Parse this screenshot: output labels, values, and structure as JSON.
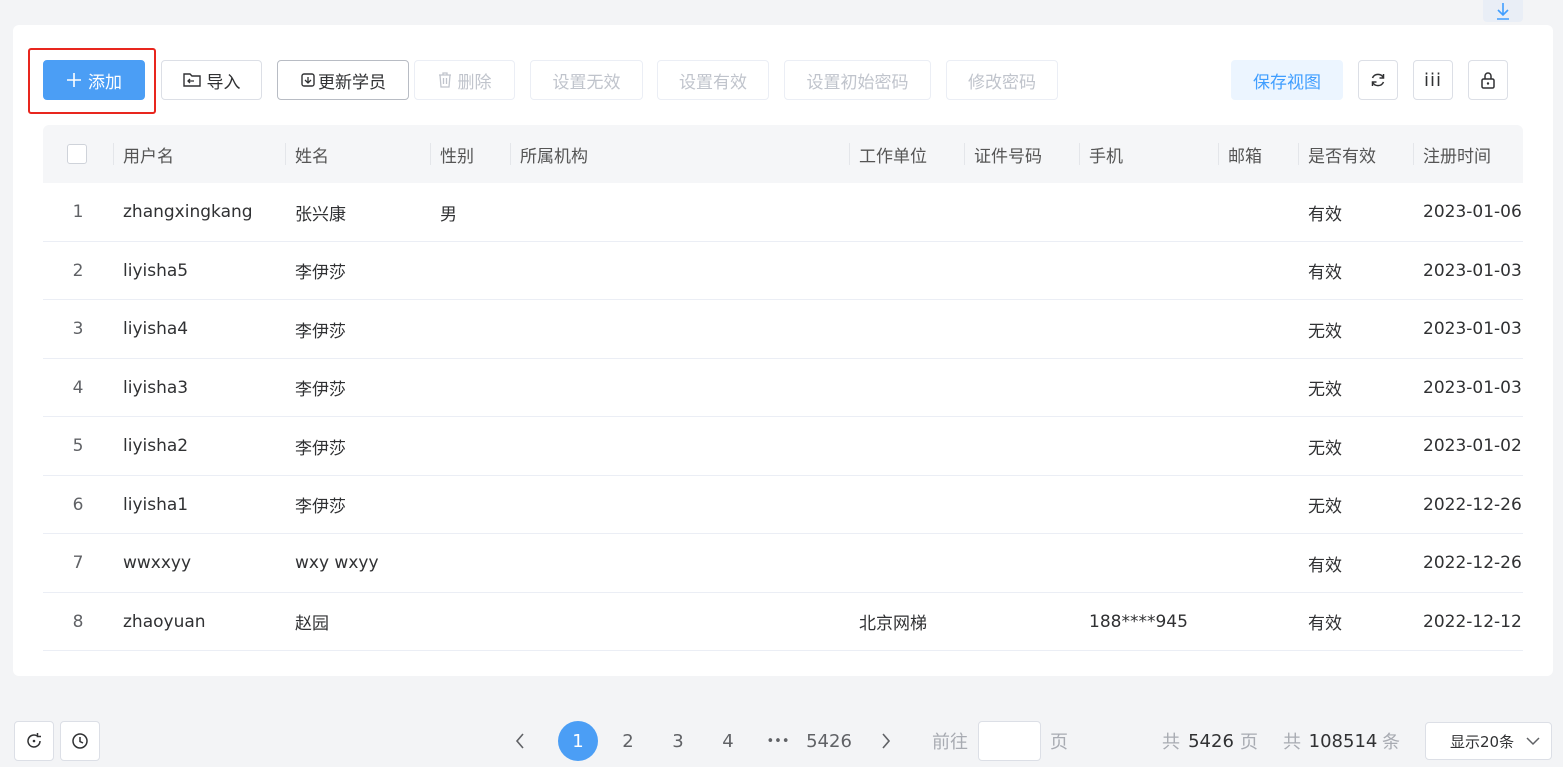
{
  "toolbar": {
    "add": "添加",
    "import": "导入",
    "update_students": "更新学员",
    "delete": "删除",
    "set_invalid": "设置无效",
    "set_valid": "设置有效",
    "set_initial_password": "设置初始密码",
    "change_password": "修改密码",
    "save_view": "保存视图",
    "columns_glyph": "iii"
  },
  "table": {
    "headers": {
      "username": "用户名",
      "name": "姓名",
      "gender": "性别",
      "org": "所属机构",
      "workplace": "工作单位",
      "id_number": "证件号码",
      "phone": "手机",
      "email": "邮箱",
      "valid": "是否有效",
      "reg_time": "注册时间"
    },
    "rows": [
      {
        "idx": "1",
        "username": "zhangxingkang",
        "name": "张兴康",
        "gender": "男",
        "org": "",
        "workplace": "",
        "id_number": "",
        "phone": "",
        "email": "",
        "valid": "有效",
        "reg_time": "2023-01-06"
      },
      {
        "idx": "2",
        "username": "liyisha5",
        "name": "李伊莎",
        "gender": "",
        "org": "",
        "workplace": "",
        "id_number": "",
        "phone": "",
        "email": "",
        "valid": "有效",
        "reg_time": "2023-01-03"
      },
      {
        "idx": "3",
        "username": "liyisha4",
        "name": "李伊莎",
        "gender": "",
        "org": "",
        "workplace": "",
        "id_number": "",
        "phone": "",
        "email": "",
        "valid": "无效",
        "reg_time": "2023-01-03"
      },
      {
        "idx": "4",
        "username": "liyisha3",
        "name": "李伊莎",
        "gender": "",
        "org": "",
        "workplace": "",
        "id_number": "",
        "phone": "",
        "email": "",
        "valid": "无效",
        "reg_time": "2023-01-03"
      },
      {
        "idx": "5",
        "username": "liyisha2",
        "name": "李伊莎",
        "gender": "",
        "org": "",
        "workplace": "",
        "id_number": "",
        "phone": "",
        "email": "",
        "valid": "无效",
        "reg_time": "2023-01-02"
      },
      {
        "idx": "6",
        "username": "liyisha1",
        "name": "李伊莎",
        "gender": "",
        "org": "",
        "workplace": "",
        "id_number": "",
        "phone": "",
        "email": "",
        "valid": "无效",
        "reg_time": "2022-12-26"
      },
      {
        "idx": "7",
        "username": "wwxxyy",
        "name": "wxy wxyy",
        "gender": "",
        "org": "",
        "workplace": "",
        "id_number": "",
        "phone": "",
        "email": "",
        "valid": "有效",
        "reg_time": "2022-12-26"
      },
      {
        "idx": "8",
        "username": "zhaoyuan",
        "name": "赵园",
        "gender": "",
        "org": "",
        "workplace": "北京网梯",
        "id_number": "",
        "phone": "188****945",
        "email": "",
        "valid": "有效",
        "reg_time": "2022-12-12"
      }
    ]
  },
  "pagination": {
    "pages": [
      "1",
      "2",
      "3",
      "4"
    ],
    "current_page": "1",
    "ellipsis": "•••",
    "last_page": "5426",
    "goto_label": "前往",
    "goto_value": "",
    "page_unit": "页",
    "total_prefix": "共",
    "total_pages": "5426",
    "total_pages_unit": "页",
    "total_items_prefix": "共",
    "total_items": "108514",
    "total_items_unit": "条",
    "page_size": "显示20条"
  },
  "colors": {
    "primary": "#4b9ef5",
    "highlight": "#e8261e"
  }
}
